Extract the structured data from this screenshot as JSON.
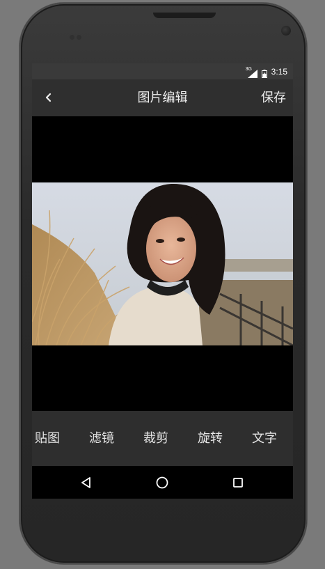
{
  "status_bar": {
    "network": "3G",
    "time": "3:15"
  },
  "app_bar": {
    "title": "图片编辑",
    "save_label": "保存",
    "back_icon": "chevron-left-icon"
  },
  "toolbar": {
    "items": [
      {
        "label": "贴图"
      },
      {
        "label": "滤镜"
      },
      {
        "label": "裁剪"
      },
      {
        "label": "旋转"
      },
      {
        "label": "文字"
      }
    ]
  },
  "nav_bar": {
    "back_icon": "triangle-back-icon",
    "home_icon": "circle-home-icon",
    "recents_icon": "square-recents-icon"
  },
  "colors": {
    "app_bar": "#2f2f2f",
    "status_bar": "#3a3a3a",
    "toolbar": "#2e2e2e",
    "text": "#eeeeee"
  }
}
